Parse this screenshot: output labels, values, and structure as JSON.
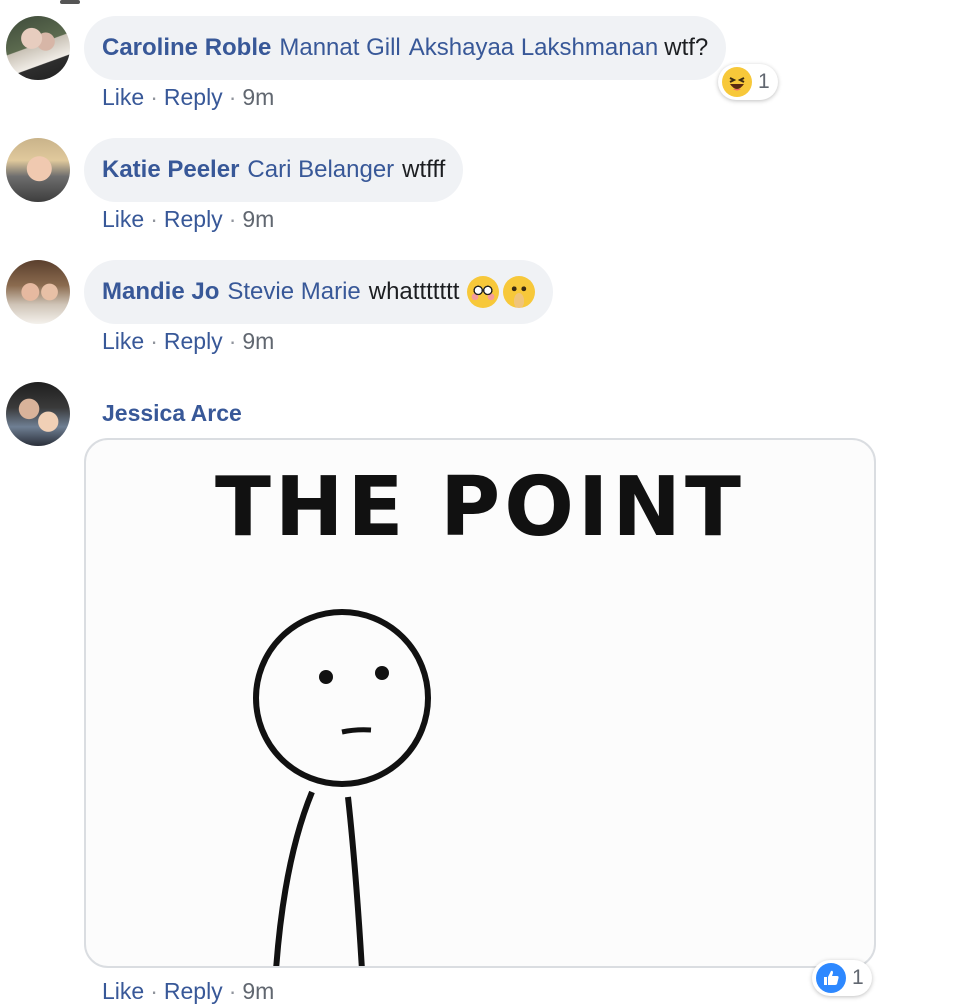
{
  "comments": [
    {
      "author": "Caroline Roble",
      "mentions": [
        "Mannat Gill",
        "Akshayaa Lakshmanan"
      ],
      "text": "wtf?",
      "actions": {
        "like": "Like",
        "reply": "Reply",
        "sep": "·",
        "time": "9m"
      },
      "reaction": {
        "type": "haha",
        "count": "1"
      }
    },
    {
      "author": "Katie Peeler",
      "mentions": [
        "Cari Belanger"
      ],
      "text": "wtfff",
      "actions": {
        "like": "Like",
        "reply": "Reply",
        "sep": "·",
        "time": "9m"
      }
    },
    {
      "author": "Mandie Jo",
      "mentions": [
        "Stevie Marie"
      ],
      "text": "whattttttt",
      "emojis": [
        "flushed-face",
        "thinking-face"
      ],
      "actions": {
        "like": "Like",
        "reply": "Reply",
        "sep": "·",
        "time": "9m"
      }
    },
    {
      "author": "Jessica Arce",
      "image": {
        "caption_text": "THE POINT",
        "icon": "stick-figure"
      },
      "actions": {
        "like": "Like",
        "reply": "Reply",
        "sep": "·",
        "time": "9m"
      },
      "reaction": {
        "type": "like",
        "count": "1"
      }
    }
  ],
  "colors": {
    "link": "#385898",
    "bubble": "#f0f2f5",
    "meta": "#616770",
    "like_blue": "#2d88ff",
    "haha_yellow": "#f7c83a"
  }
}
